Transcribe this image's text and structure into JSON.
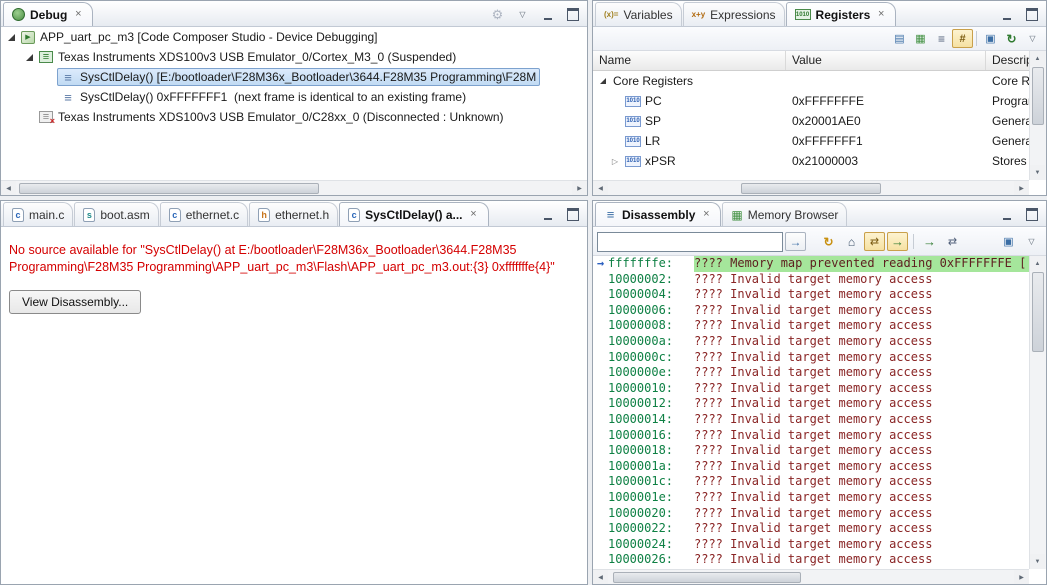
{
  "debug": {
    "tabs": [
      {
        "label": "Debug",
        "icon": "debug",
        "cls": "sel"
      }
    ],
    "tree": [
      {
        "label": "APP_uart_pc_m3 [Code Composer Studio - Device Debugging]",
        "icon": "launch",
        "cls": "ind0 exp-open"
      },
      {
        "label": "Texas Instruments XDS100v3 USB Emulator_0/Cortex_M3_0 (Suspended)",
        "icon": "core",
        "cls": "ind1 exp-open"
      },
      {
        "label": "SysCtlDelay() [E:/bootloader\\F28M36x_Bootloader\\3644.F28M35 Programming\\F28M",
        "icon": "stack-frame",
        "cls": "ind2 sel"
      },
      {
        "label": "SysCtlDelay() 0xFFFFFFF1  (next frame is identical to an existing frame)",
        "icon": "stack-frame",
        "cls": "ind2"
      },
      {
        "label": "Texas Instruments XDS100v3 USB Emulator_0/C28xx_0 (Disconnected : Unknown)",
        "icon": "core-disconnected",
        "cls": "ind1"
      }
    ]
  },
  "registers_view": {
    "tabs": [
      {
        "label": "Variables",
        "icon": "variables",
        "cls": ""
      },
      {
        "label": "Expressions",
        "icon": "expressions",
        "cls": ""
      },
      {
        "label": "Registers",
        "icon": "registers",
        "cls": "sel"
      }
    ],
    "columns": {
      "name": "Name",
      "value": "Value",
      "description": "Descripti"
    },
    "rows": [
      {
        "name": "Core Registers",
        "value": "",
        "desc": "Core Reg",
        "icon": "",
        "cls": "grp exp-open"
      },
      {
        "name": "PC",
        "value": "0xFFFFFFFE",
        "desc": "Program",
        "icon": "binary",
        "cls": "child"
      },
      {
        "name": "SP",
        "value": "0x20001AE0",
        "desc": "General P",
        "icon": "binary",
        "cls": "child"
      },
      {
        "name": "LR",
        "value": "0xFFFFFFF1",
        "desc": "General P",
        "icon": "binary",
        "cls": "child"
      },
      {
        "name": "xPSR",
        "value": "0x21000003",
        "desc": "Stores th",
        "icon": "binary",
        "cls": "child exp-closed"
      }
    ]
  },
  "editor": {
    "tabs": [
      {
        "label": "main.c",
        "icon": "file-c",
        "cls": ""
      },
      {
        "label": "boot.asm",
        "icon": "file-s",
        "cls": ""
      },
      {
        "label": "ethernet.c",
        "icon": "file-c",
        "cls": ""
      },
      {
        "label": "ethernet.h",
        "icon": "file-h",
        "cls": ""
      },
      {
        "label": "SysCtlDelay() a...",
        "icon": "file-c",
        "cls": "sel"
      }
    ],
    "message_line1": "No source available for \"SysCtlDelay() at E:/bootloader\\F28M36x_Bootloader\\3644.F28M35",
    "message_line2": "Programming\\F28M35 Programming\\APP_uart_pc_m3\\Flash\\APP_uart_pc_m3.out:{3} 0xfffffffe{4}\"",
    "view_disassembly_button": "View Disassembly..."
  },
  "disassembly_view": {
    "tabs": [
      {
        "label": "Disassembly",
        "icon": "disassembly",
        "cls": "sel"
      },
      {
        "label": "Memory Browser",
        "icon": "memory",
        "cls": ""
      }
    ],
    "address_input_value": "",
    "rows": [
      {
        "addr": "fffffffe:",
        "text": "???? Memory map prevented reading 0xFFFFFFFE [",
        "cls": "hl pc"
      },
      {
        "addr": "10000002:",
        "text": "???? Invalid target memory access"
      },
      {
        "addr": "10000004:",
        "text": "???? Invalid target memory access"
      },
      {
        "addr": "10000006:",
        "text": "???? Invalid target memory access"
      },
      {
        "addr": "10000008:",
        "text": "???? Invalid target memory access"
      },
      {
        "addr": "1000000a:",
        "text": "???? Invalid target memory access"
      },
      {
        "addr": "1000000c:",
        "text": "???? Invalid target memory access"
      },
      {
        "addr": "1000000e:",
        "text": "???? Invalid target memory access"
      },
      {
        "addr": "10000010:",
        "text": "???? Invalid target memory access"
      },
      {
        "addr": "10000012:",
        "text": "???? Invalid target memory access"
      },
      {
        "addr": "10000014:",
        "text": "???? Invalid target memory access"
      },
      {
        "addr": "10000016:",
        "text": "???? Invalid target memory access"
      },
      {
        "addr": "10000018:",
        "text": "???? Invalid target memory access"
      },
      {
        "addr": "1000001a:",
        "text": "???? Invalid target memory access"
      },
      {
        "addr": "1000001c:",
        "text": "???? Invalid target memory access"
      },
      {
        "addr": "1000001e:",
        "text": "???? Invalid target memory access"
      },
      {
        "addr": "10000020:",
        "text": "???? Invalid target memory access"
      },
      {
        "addr": "10000022:",
        "text": "???? Invalid target memory access"
      },
      {
        "addr": "10000024:",
        "text": "???? Invalid target memory access"
      },
      {
        "addr": "10000026:",
        "text": "???? Invalid target memory access"
      }
    ]
  },
  "colors": {
    "selection_blue": "#c1dbf3",
    "disasm_highlight_green": "#a5e69b",
    "address_green": "#0e8044",
    "invalid_text_maroon": "#8a2525",
    "error_red": "#d40000"
  }
}
